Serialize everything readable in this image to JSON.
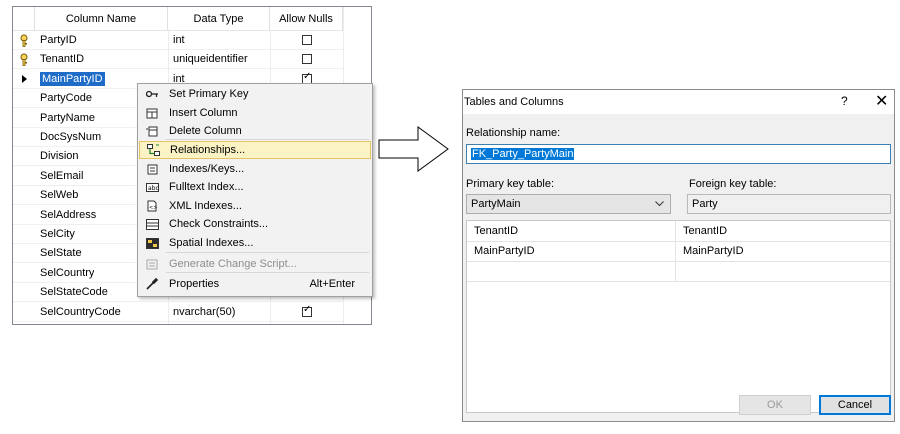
{
  "designer": {
    "headers": {
      "column_name": "Column Name",
      "data_type": "Data Type",
      "allow_nulls": "Allow Nulls"
    },
    "rows": [
      {
        "name": "PartyID",
        "type": "int",
        "key": true,
        "nulls": false
      },
      {
        "name": "TenantID",
        "type": "uniqueidentifier",
        "key": true,
        "nulls": false
      },
      {
        "name": "MainPartyID",
        "type": "int",
        "key": false,
        "nulls": true,
        "selected": true
      },
      {
        "name": "PartyCode"
      },
      {
        "name": "PartyName"
      },
      {
        "name": "DocSysNum"
      },
      {
        "name": "Division"
      },
      {
        "name": "SelEmail"
      },
      {
        "name": "SelWeb"
      },
      {
        "name": "SelAddress"
      },
      {
        "name": "SelCity"
      },
      {
        "name": "SelState"
      },
      {
        "name": "SelCountry"
      },
      {
        "name": "SelStateCode"
      },
      {
        "name": "SelCountryCode",
        "type": "nvarchar(50)",
        "nulls": true
      }
    ]
  },
  "context_menu": {
    "items": [
      {
        "label": "Set Primary Key",
        "icon": "key-icon"
      },
      {
        "label": "Insert Column",
        "icon": "insert-column-icon"
      },
      {
        "label": "Delete Column",
        "icon": "delete-column-icon"
      },
      {
        "label": "Relationships...",
        "icon": "relationships-icon",
        "highlighted": true
      },
      {
        "label": "Indexes/Keys...",
        "icon": "indexes-icon"
      },
      {
        "label": "Fulltext Index...",
        "icon": "fulltext-icon"
      },
      {
        "label": "XML Indexes...",
        "icon": "xml-indexes-icon"
      },
      {
        "label": "Check Constraints...",
        "icon": "check-constraints-icon"
      },
      {
        "label": "Spatial Indexes...",
        "icon": "spatial-indexes-icon"
      },
      {
        "label": "Generate Change Script...",
        "icon": "change-script-icon",
        "disabled": true
      },
      {
        "label": "Properties",
        "icon": "wrench-icon",
        "shortcut": "Alt+Enter"
      }
    ]
  },
  "dialog": {
    "title": "Tables and Columns",
    "help": "?",
    "close": "✕",
    "relationship_label": "Relationship name:",
    "relationship_value": "FK_Party_PartyMain",
    "primary_label": "Primary key table:",
    "primary_value": "PartyMain",
    "foreign_label": "Foreign key table:",
    "foreign_value": "Party",
    "mapping": [
      {
        "primary": "TenantID",
        "foreign": "TenantID"
      },
      {
        "primary": "MainPartyID",
        "foreign": "MainPartyID"
      }
    ],
    "ok": "OK",
    "cancel": "Cancel"
  }
}
